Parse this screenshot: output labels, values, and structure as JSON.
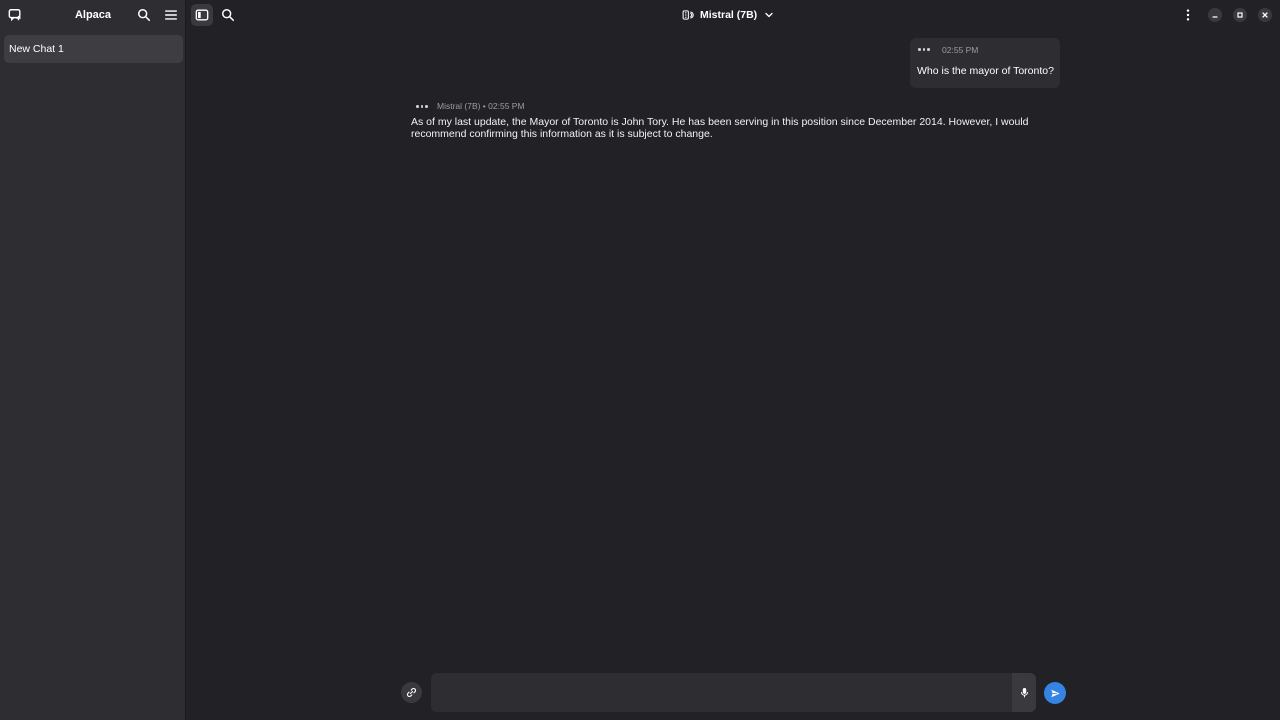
{
  "sidebar": {
    "app_title": "Alpaca",
    "chats": [
      {
        "label": "New Chat 1"
      }
    ]
  },
  "header": {
    "model_name": "Mistral (7B)"
  },
  "messages": [
    {
      "role": "user",
      "time": "02:55 PM",
      "text": "Who is the mayor of Toronto?"
    },
    {
      "role": "assistant",
      "meta": "Mistral (7B) • 02:55 PM",
      "text": "As of my last update, the Mayor of Toronto is John Tory. He has been serving in this position since December 2014. However, I would recommend confirming this information as it is subject to change."
    }
  ],
  "composer": {
    "value": "",
    "placeholder": ""
  },
  "colors": {
    "background": "#222226",
    "sidebar": "#2e2e32",
    "accent": "#3584e4"
  }
}
